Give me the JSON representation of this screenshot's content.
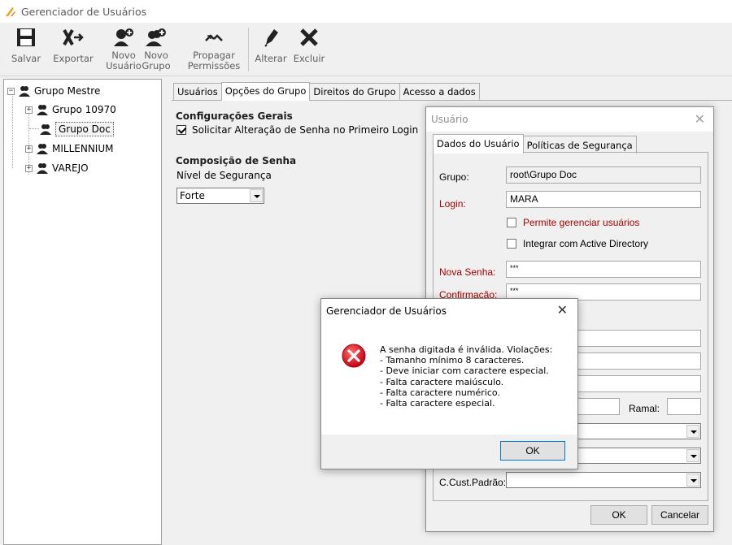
{
  "window": {
    "title": "Gerenciador de Usuários"
  },
  "toolbar": {
    "save": "Salvar",
    "export": "Exportar",
    "new_user": [
      "Novo",
      "Usuário"
    ],
    "new_group": [
      "Novo",
      "Grupo"
    ],
    "propagate": [
      "Propagar",
      "Permissões"
    ],
    "edit": "Alterar",
    "delete": "Excluir"
  },
  "tree": {
    "root": "Grupo Mestre",
    "children": [
      "Grupo 10970",
      "Grupo Doc",
      "MILLENNIUM",
      "VAREJO"
    ],
    "selected": "Grupo Doc"
  },
  "main_tabs": [
    "Usuários",
    "Opções do Grupo",
    "Direitos do Grupo",
    "Acesso a dados"
  ],
  "group_options": {
    "general_title": "Configurações Gerais",
    "require_change": "Solicitar Alteração de Senha no Primeiro Login",
    "password_title": "Composição de Senha",
    "security_level_label": "Nível de Segurança",
    "security_level_value": "Forte"
  },
  "user_dialog": {
    "title": "Usuário",
    "tabs": [
      "Dados do Usuário",
      "Políticas de Segurança"
    ],
    "group_label": "Grupo:",
    "group_value": "root\\Grupo Doc",
    "login_label": "Login:",
    "login_value": "MARA",
    "allow_manage": "Permite gerenciar usuários",
    "integrate_ad": "Integrar com Active Directory",
    "new_password_label": "Nova Senha:",
    "new_password_value": "***",
    "confirm_label": "Confirmação:",
    "confirm_value": "***",
    "extension_label": "Ramal:",
    "cost_center_label": "C.Cust.Padrão:",
    "ok": "OK",
    "cancel": "Cancelar"
  },
  "error_dialog": {
    "title": "Gerenciador de Usuários",
    "message": "A senha digitada é inválida. Violações:\n- Tamanho mínimo 8 caracteres.\n- Deve iniciar com caractere especial.\n- Falta caractere maiúsculo.\n- Falta caractere numérico.\n- Falta caractere especial.",
    "ok": "OK",
    "icon": "error-icon"
  },
  "colors": {
    "accent": "#0078d7",
    "required_label": "#a50000",
    "error_icon": "#d0021b"
  }
}
